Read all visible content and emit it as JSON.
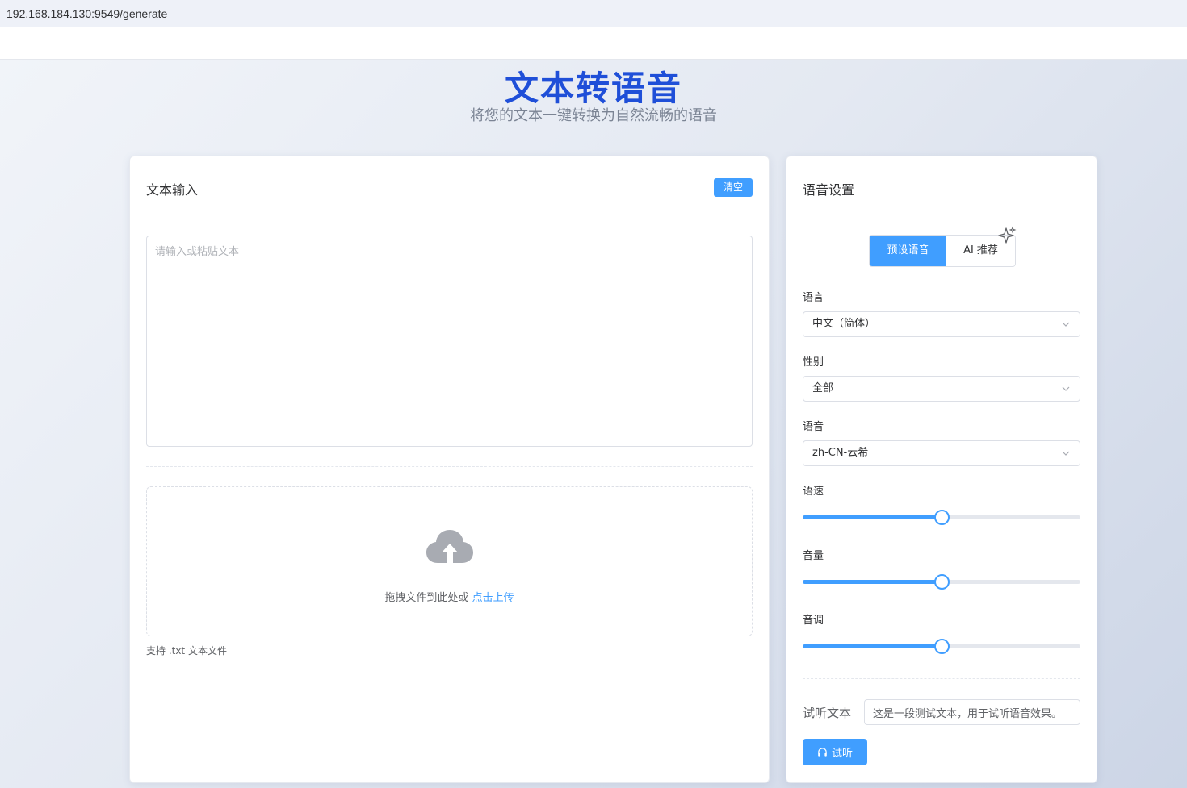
{
  "browser": {
    "url": "192.168.184.130:9549/generate"
  },
  "hero": {
    "title": "文本转语音",
    "subtitle": "将您的文本一键转换为自然流畅的语音"
  },
  "text_input": {
    "title": "文本输入",
    "clear_label": "清空",
    "textarea_placeholder": "请输入或粘贴文本",
    "textarea_value": "",
    "upload_prompt": "拖拽文件到此处或",
    "upload_link": "点击上传",
    "upload_tip": "支持 .txt 文本文件",
    "upload_icon": "cloud-upload-icon"
  },
  "voice_settings": {
    "title": "语音设置",
    "tabs": [
      {
        "label": "预设语音",
        "active": true
      },
      {
        "label": "AI 推荐",
        "active": false
      }
    ],
    "sparkle_icon": "sparkle-icon",
    "language": {
      "label": "语言",
      "value": "中文（简体）"
    },
    "gender": {
      "label": "性别",
      "value": "全部"
    },
    "voice": {
      "label": "语音",
      "value": "zh-CN-云希"
    },
    "sliders": [
      {
        "label": "语速",
        "fraction": 0.5
      },
      {
        "label": "音量",
        "fraction": 0.5
      },
      {
        "label": "音调",
        "fraction": 0.5
      }
    ],
    "preview": {
      "label": "试听文本",
      "value": "这是一段测试文本，用于试听语音效果。",
      "button_label": "试听",
      "button_icon": "headphones-icon"
    }
  },
  "colors": {
    "primary": "#409eff",
    "title": "#1f4fd8"
  }
}
